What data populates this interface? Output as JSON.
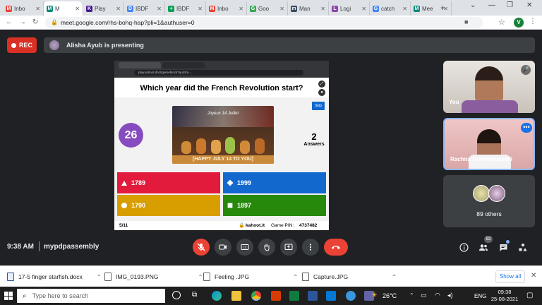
{
  "browser": {
    "tabs": [
      {
        "label": "Inbo",
        "fav": "M",
        "color": "#ea4335"
      },
      {
        "label": "M",
        "fav": "M",
        "color": "#00897b",
        "active": true
      },
      {
        "label": "Play",
        "fav": "K",
        "color": "#46178f"
      },
      {
        "label": "IBDF",
        "fav": "D",
        "color": "#4285f4"
      },
      {
        "label": "IBDF",
        "fav": "+",
        "color": "#0f9d58"
      },
      {
        "label": "Inbo",
        "fav": "M",
        "color": "#ea4335"
      },
      {
        "label": "Goo",
        "fav": "G",
        "color": "#34a853"
      },
      {
        "label": "Man",
        "fav": "m",
        "color": "#3c4a60"
      },
      {
        "label": "Logi",
        "fav": "L",
        "color": "#8e44ad"
      },
      {
        "label": "catch",
        "fav": "G",
        "color": "#4285f4"
      },
      {
        "label": "Mee",
        "fav": "M",
        "color": "#00897b"
      }
    ],
    "new_tab": "+",
    "url": "meet.google.com/rhs-bohq-hap?pli=1&authuser=0",
    "profile_initial": "V"
  },
  "meet": {
    "rec_label": "REC",
    "presenting_text": "Alisha Ayub is presenting",
    "time": "9:38 AM",
    "meeting_code": "mypdpassembly",
    "people_count": "92",
    "participants": [
      {
        "name": "You"
      },
      {
        "name": "Rachna Govindayapalli"
      }
    ],
    "others_label": "89 others"
  },
  "slide": {
    "browser_url": "play.kahoot.it/v2/gameblock?quizId=...",
    "question": "Which year did the French Revolution start?",
    "timer": "26",
    "skip": "Skip",
    "answers_count": "2",
    "answers_label": "Answers",
    "image_caption": "HAPPY JULY 14 TO YOU",
    "image_text": "Joyeux 14 Juillet",
    "options": [
      {
        "label": "1789",
        "color": "#e21b3c",
        "shape": "triangle"
      },
      {
        "label": "1999",
        "color": "#1368ce",
        "shape": "diamond"
      },
      {
        "label": "1790",
        "color": "#d89e00",
        "shape": "circle"
      },
      {
        "label": "1897",
        "color": "#26890c",
        "shape": "square"
      }
    ],
    "progress": "5/11",
    "brand": "kahoot.it",
    "pin_label": "Game PIN:",
    "pin": "4737482"
  },
  "downloads": {
    "items": [
      "17-5 finger starfish.docx",
      "IMG_0193.PNG",
      "Feeling .JPG",
      "Capture.JPG"
    ],
    "show_all": "Show all"
  },
  "taskbar": {
    "search_placeholder": "Type here to search",
    "weather": "26°C",
    "lang": "ENG",
    "time": "09:38",
    "date": "25-08-2021"
  }
}
